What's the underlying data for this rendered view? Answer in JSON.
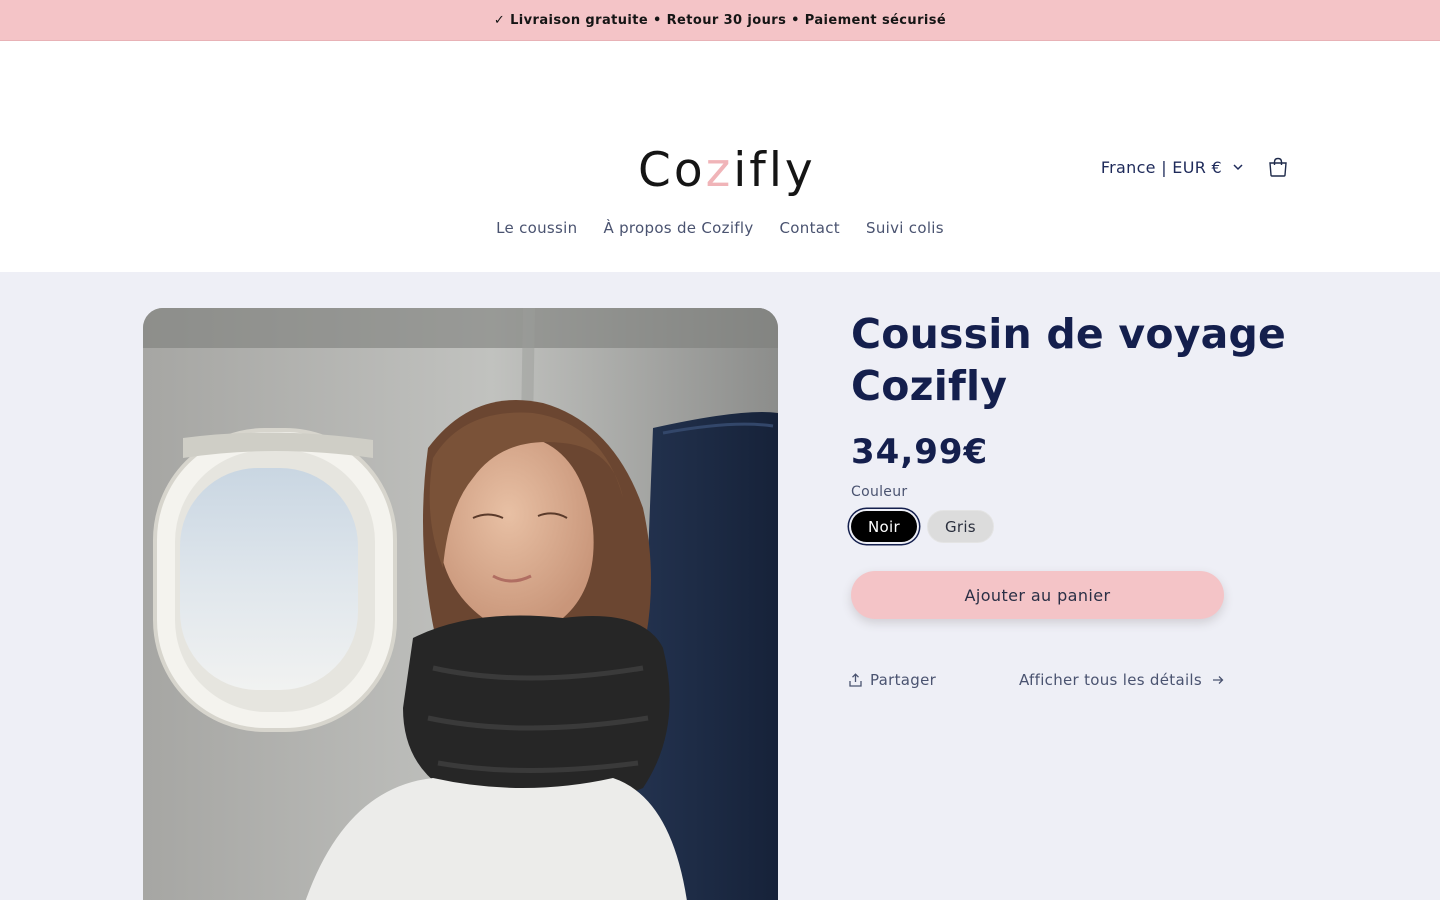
{
  "announcement": "✓ Livraison gratuite • Retour 30 jours • Paiement sécurisé",
  "header": {
    "logo_part1": "Co",
    "logo_accent": "z",
    "logo_part2": "ifly",
    "locale": "France | EUR €"
  },
  "nav": [
    {
      "label": "Le coussin"
    },
    {
      "label": "À propos de Cozifly"
    },
    {
      "label": "Contact"
    },
    {
      "label": "Suivi colis"
    }
  ],
  "product": {
    "title": "Coussin de voyage Cozifly",
    "price": "34,99€",
    "option_label": "Couleur",
    "options": [
      {
        "label": "Noir",
        "selected": true
      },
      {
        "label": "Gris",
        "selected": false
      }
    ],
    "add_to_cart": "Ajouter au panier",
    "share": "Partager",
    "details_link": "Afficher tous les détails"
  },
  "colors": {
    "announcement_bg": "#f4c4c7",
    "brand_navy": "#141f4d",
    "page_bg": "#eeeff6",
    "accent_pink": "#f0b4b8"
  },
  "icons": [
    "chevron-down-icon",
    "cart-icon",
    "share-icon",
    "arrow-right-icon"
  ]
}
